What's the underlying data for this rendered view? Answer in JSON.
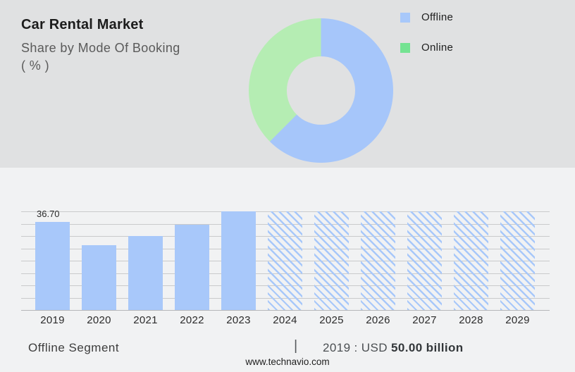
{
  "header": {
    "title": "Car Rental Market",
    "subtitle_line1": "Share by Mode Of Booking",
    "subtitle_line2": "( % )"
  },
  "legend": {
    "items": [
      {
        "label": "Offline",
        "color": "#a8c8fa"
      },
      {
        "label": "Online",
        "color": "#74e392"
      }
    ]
  },
  "chart_data": [
    {
      "type": "pie",
      "subtype": "donut",
      "title": "Share by Mode Of Booking ( % )",
      "direction": "clockwise",
      "start_angle_deg": 0,
      "hole_ratio": 0.47,
      "segments": [
        {
          "label": "Offline",
          "value": 62.5,
          "color": "#a6c6fa"
        },
        {
          "label": "Online",
          "value": 37.5,
          "color": "#b5edb3"
        }
      ]
    },
    {
      "type": "bar",
      "title": "Offline Segment",
      "categories": [
        "2019",
        "2020",
        "2021",
        "2022",
        "2023",
        "2024",
        "2025",
        "2026",
        "2027",
        "2028",
        "2029"
      ],
      "values": [
        36.7,
        27.0,
        30.8,
        35.5,
        41.1,
        41.1,
        41.1,
        41.1,
        41.1,
        41.1,
        41.1
      ],
      "forecast": [
        false,
        false,
        false,
        false,
        false,
        true,
        true,
        true,
        true,
        true,
        true
      ],
      "data_labels": [
        {
          "category": "2019",
          "text": "36.70"
        }
      ],
      "ylim": [
        0,
        41.1
      ],
      "gridline_count": 9,
      "grid": true,
      "bar_color": "#a8c8fa",
      "legend_position": "none"
    }
  ],
  "footer": {
    "segment_label": "Offline Segment",
    "separator": "|",
    "value_prefix": "2019 : USD",
    "value_bold": "50.00 billion",
    "website": "www.technavio.com"
  },
  "colors": {
    "top_background": "#e0e1e2",
    "bottom_background": "#f1f2f3",
    "gridline": "#c9cacb",
    "bar_blue": "#a8c8fa",
    "donut_blue": "#a6c6fa",
    "donut_green": "#b5edb3",
    "legend_green": "#74e392"
  }
}
